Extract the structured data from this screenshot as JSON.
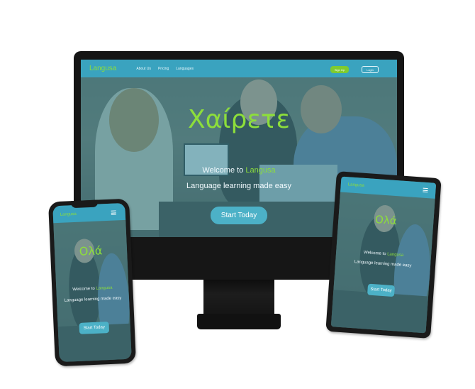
{
  "site": {
    "logo": "Langusa",
    "nav": [
      "About Us",
      "Pricing",
      "Languages"
    ],
    "signup_label": "Sign Up",
    "login_label": "Login",
    "welcome_prefix": "Welcome to ",
    "brand": "Langusa",
    "tagline": "Language learning made easy",
    "cta_label": "Start Today"
  },
  "desktop": {
    "greeting": "Χαίρετε"
  },
  "phone": {
    "greeting": "Ολά"
  },
  "tablet": {
    "greeting": "Ολά"
  },
  "colors": {
    "navbar": "#3aa3bf",
    "accent_green": "#8dde3b",
    "button_green": "#7fcb30",
    "cta": "#4cb1c7",
    "overlay": "#308292",
    "device_frame": "#151515"
  },
  "icons": {
    "menu": "hamburger-icon"
  }
}
